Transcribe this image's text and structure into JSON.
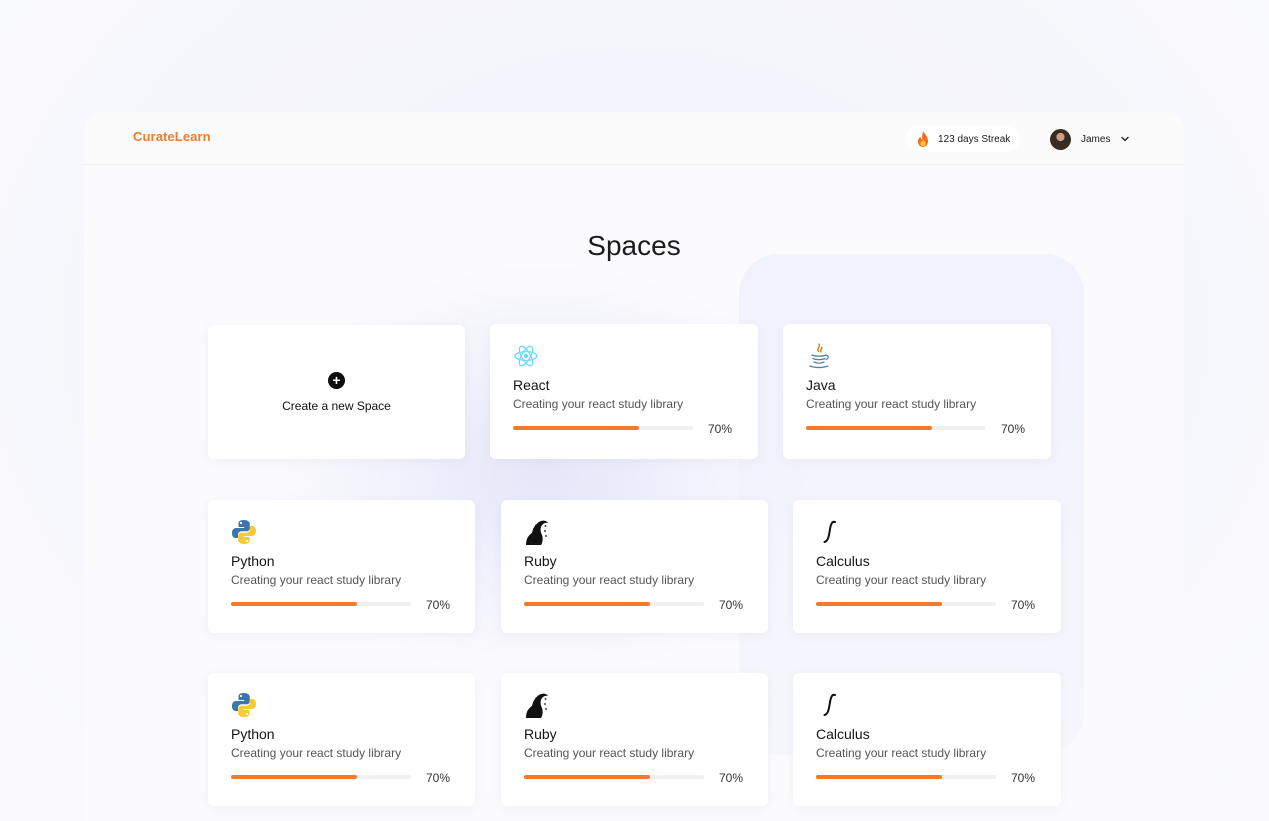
{
  "app": {
    "brand": "CurateLearn"
  },
  "header": {
    "streak_label": "123 days Streak",
    "user_name": "James"
  },
  "page": {
    "title": "Spaces"
  },
  "create_card": {
    "label": "Create a new Space"
  },
  "spaces": [
    {
      "icon": "react-icon",
      "title": "React",
      "subtitle": "Creating your react study library",
      "progress": 0.7,
      "progress_label": "70%"
    },
    {
      "icon": "java-icon",
      "title": "Java",
      "subtitle": "Creating your react study library",
      "progress": 0.7,
      "progress_label": "70%"
    },
    {
      "icon": "python-icon",
      "title": "Python",
      "subtitle": "Creating your react study library",
      "progress": 0.7,
      "progress_label": "70%"
    },
    {
      "icon": "ruby-icon",
      "title": "Ruby",
      "subtitle": "Creating your react study library",
      "progress": 0.7,
      "progress_label": "70%"
    },
    {
      "icon": "calculus-icon",
      "title": "Calculus",
      "subtitle": "Creating your react study library",
      "progress": 0.7,
      "progress_label": "70%"
    },
    {
      "icon": "python-icon",
      "title": "Python",
      "subtitle": "Creating your react study library",
      "progress": 0.7,
      "progress_label": "70%"
    },
    {
      "icon": "ruby-icon",
      "title": "Ruby",
      "subtitle": "Creating your react study library",
      "progress": 0.7,
      "progress_label": "70%"
    },
    {
      "icon": "calculus-icon",
      "title": "Calculus",
      "subtitle": "Creating your react study library",
      "progress": 0.7,
      "progress_label": "70%"
    }
  ],
  "colors": {
    "accent": "#f47a2a",
    "track": "#f0f0f0",
    "react": "#61dafb",
    "python_blue": "#3a76ab",
    "python_yellow": "#f6c93a"
  }
}
